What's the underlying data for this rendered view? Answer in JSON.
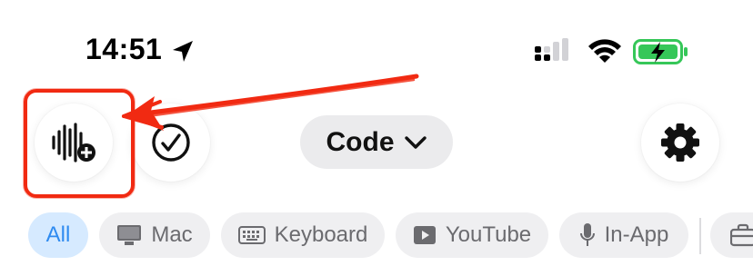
{
  "status_bar": {
    "time": "14:51",
    "icons": [
      "location-arrow-icon",
      "cellular-signal-icon",
      "wifi-icon",
      "battery-charging-icon"
    ],
    "battery_color": "#36c759"
  },
  "toolbar": {
    "voice_button_icon": "waveform-plus-icon",
    "check_button_icon": "checkmark-circle-icon",
    "mode_dropdown": {
      "label": "Code",
      "icon": "chevron-down-icon"
    },
    "settings_button_icon": "gear-icon"
  },
  "filter_chips": [
    {
      "label": "All",
      "icon": "",
      "selected": true
    },
    {
      "label": "Mac",
      "icon": "desktop-icon",
      "selected": false
    },
    {
      "label": "Keyboard",
      "icon": "keyboard-icon",
      "selected": false
    },
    {
      "label": "YouTube",
      "icon": "play-icon",
      "selected": false
    },
    {
      "label": "In-App",
      "icon": "microphone-icon",
      "selected": false
    },
    {
      "label": "",
      "icon": "briefcase-icon",
      "selected": false
    }
  ],
  "annotation": {
    "color": "#f12a12",
    "type": "hand-drawn arrow and box highlighting the voice button"
  },
  "colors": {
    "selected_chip_bg": "#d6eaff",
    "selected_chip_text": "#2f8bf0",
    "chip_bg": "#efeff1",
    "dropdown_bg": "#ebebed"
  }
}
